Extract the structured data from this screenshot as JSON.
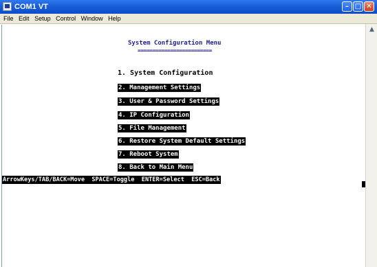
{
  "window": {
    "title": "COM1 VT",
    "minimize_label": "–",
    "maximize_label": "□",
    "close_label": "✕"
  },
  "menubar": [
    "File",
    "Edit",
    "Setup",
    "Control",
    "Window",
    "Help"
  ],
  "terminal": {
    "title": "System Configuration Menu",
    "underline": "=========================",
    "items": [
      "1. System Configuration",
      "2. Management Settings",
      "3. User & Password Settings",
      "4. IP Configuration",
      "5. File Management",
      "6. Restore System Default Settings",
      "7. Reboot System",
      "8. Back to Main Menu"
    ],
    "selected_index": 0,
    "status_line": "ArrowKeys/TAB/BACK=Move  SPACE=Toggle  ENTER=Select  ESC=Back"
  },
  "scrollbar": {
    "up_arrow": "▲"
  },
  "colors": {
    "titlebar": "#0c4bc9",
    "menu_bg": "#ece9d8",
    "title_text": "#1f1f8f",
    "highlight_bg": "#000000",
    "highlight_fg": "#ffffff"
  }
}
